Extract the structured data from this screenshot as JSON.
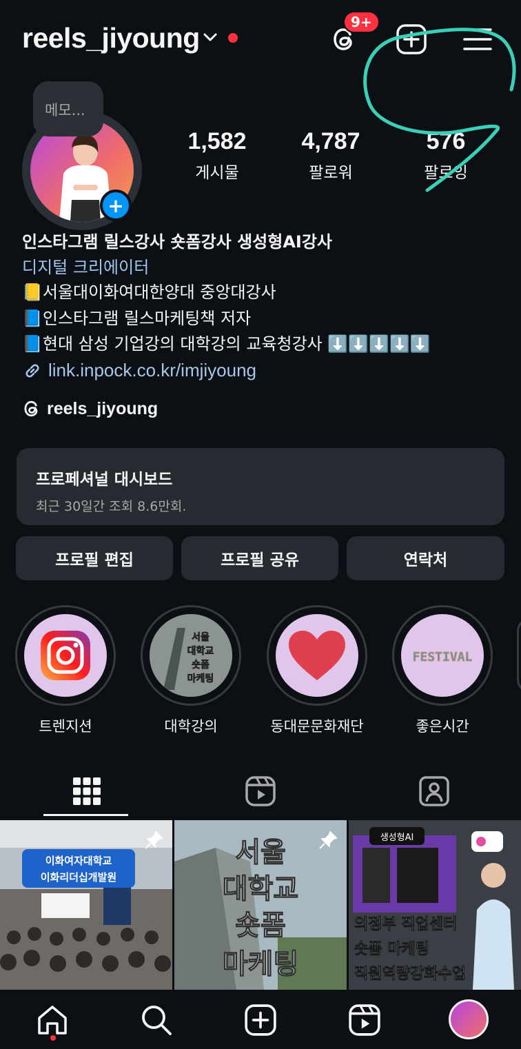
{
  "header": {
    "username": "reels_jiyoung",
    "threads_badge": "9+",
    "icons": [
      "chevron-down-icon",
      "threads-icon",
      "new-post-icon",
      "menu-icon"
    ]
  },
  "profile": {
    "memo": "메모...",
    "stats": [
      {
        "value": "1,582",
        "label": "게시물"
      },
      {
        "value": "4,787",
        "label": "팔로워"
      },
      {
        "value": "576",
        "label": "팔로잉"
      }
    ],
    "bio_name": "인스타그램 릴스강사 숏폼강사  생성형AI강사",
    "category": "디지털 크리에이터",
    "bio_lines": [
      "📒서울대이화여대한양대 중앙대강사",
      "📘인스타그램 릴스마케팅책 저자",
      "📘현대 삼성 기업강의 대학강의 교육청강사 ⬇️⬇️⬇️⬇️⬇️"
    ],
    "link": "link.inpock.co.kr/imjiyoung",
    "threads_handle": "reels_jiyoung"
  },
  "dashboard": {
    "title": "프로페셔널 대시보드",
    "subtitle": "최근 30일간 조회 8.6만회."
  },
  "buttons": {
    "edit": "프로필 편집",
    "share": "프로필 공유",
    "contact": "연락처"
  },
  "highlights": [
    {
      "label": "트렌지션",
      "cover_text": ""
    },
    {
      "label": "대학강의",
      "cover_text": "서울\n대학교\n숏폼\n마케팅"
    },
    {
      "label": "동대문문화재단",
      "cover_text": ""
    },
    {
      "label": "좋은시간",
      "cover_text": "FESTIVAL"
    }
  ],
  "posts": [
    {
      "line1": "이화여자대학교",
      "line2": "이화리더십개발원"
    },
    {
      "text": "서울\n대학교\n숏폼\n마케팅"
    },
    {
      "tag": "생성형AI",
      "lines": [
        "의정부 직업센터",
        "숏폼 마케팅",
        "직원역량강화수업"
      ]
    }
  ],
  "colors": {
    "background": "#0c1014",
    "card": "#262b31",
    "accent_blue": "#0095f6",
    "notification_red": "#ff3040",
    "link_blue": "#a7c7e9",
    "scribble": "#3ad0b8"
  }
}
